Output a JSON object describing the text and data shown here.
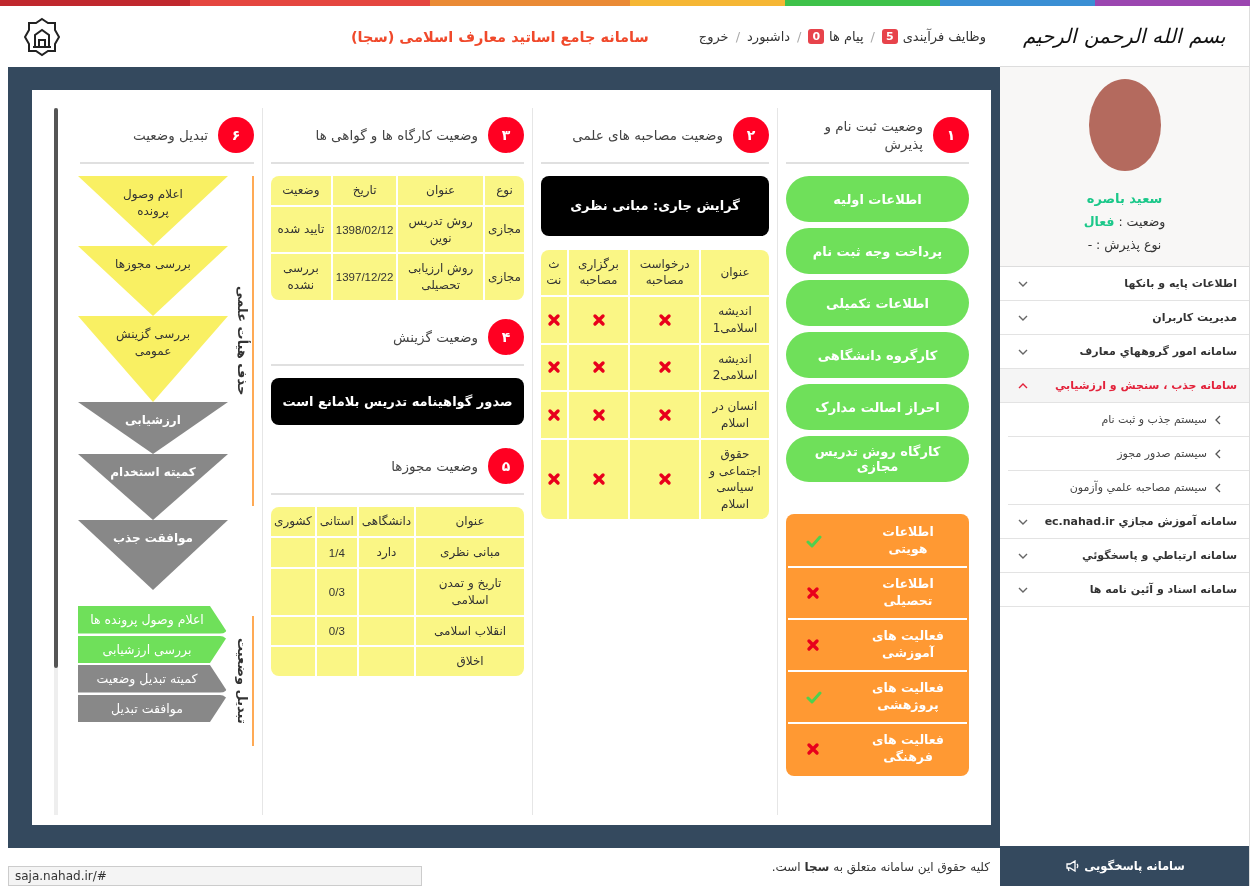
{
  "header": {
    "title": "سامانه جامع اساتید معارف اسلامی (سجا)",
    "nav": [
      {
        "label": "وظایف فرآیندی",
        "badge": "5",
        "separator": "/"
      },
      {
        "label": "پیام ها",
        "badge": "0",
        "separator": "/"
      },
      {
        "label": "داشبورد",
        "separator": "/"
      },
      {
        "label": "خروج"
      }
    ]
  },
  "board": {
    "registration": {
      "number": "۱",
      "title": "وضعیت ثبت نام و پذیرش",
      "steps": [
        "اطلاعات اولیه",
        "پرداخت وجه ثبت نام",
        "اطلاعات تکمیلی",
        "کارگروه دانشگاهی",
        "احراز اصالت مدارک",
        "کارگاه روش تدریس مجازی"
      ],
      "documents": [
        {
          "label": "اطلاعات هویتی",
          "done": true
        },
        {
          "label": "اطلاعات تحصیلی",
          "done": false
        },
        {
          "label": "فعالیت های آموزشی",
          "done": false
        },
        {
          "label": "فعالیت های پروژهشی",
          "done": true
        },
        {
          "label": "فعالیت های فرهنگی",
          "done": false
        }
      ]
    },
    "interviews": {
      "number": "۲",
      "title": "وضعیت مصاحبه های علمی",
      "current": "گرایش جاری: مبانی نظری",
      "columns": [
        "عنوان",
        "درخواست مصاحبه",
        "برگزاری مصاحبه",
        "ث نت"
      ],
      "rows": [
        {
          "title": "اندیشه اسلامی1",
          "marks": [
            false,
            false,
            false
          ]
        },
        {
          "title": "اندیشه اسلامی2",
          "marks": [
            false,
            false,
            false
          ]
        },
        {
          "title": "انسان در اسلام",
          "marks": [
            false,
            false,
            false
          ]
        },
        {
          "title": "حقوق اجتماعی و سیاسی اسلام",
          "marks": [
            false,
            false,
            false
          ]
        }
      ]
    },
    "workshops": {
      "number": "۳",
      "title": "وضعیت کارگاه ها و گواهی ها",
      "columns": [
        "نوع",
        "عنوان",
        "تاریخ",
        "وضعیت"
      ],
      "rows": [
        [
          "مجازی",
          "روش تدریس نوین",
          "1398/02/12",
          "تایید شده"
        ],
        [
          "مجازی",
          "روش ارزیابی تحصیلی",
          "1397/12/22",
          "بررسی نشده"
        ]
      ]
    },
    "selection": {
      "number": "۴",
      "title": "وضعیت گزینش",
      "message": "صدور گواهینامه تدریس بلامانع است"
    },
    "permits": {
      "number": "۵",
      "title": "وضعیت مجوزها",
      "columns": [
        "عنوان",
        "دانشگاهی",
        "استانی",
        "کشوری"
      ],
      "rows": [
        {
          "title": "مبانی نظری",
          "university": "دارد",
          "provincial": "1/4"
        },
        {
          "title": "تاریخ و تمدن اسلامی",
          "provincial": "0/3"
        },
        {
          "title": "انقلاب اسلامی",
          "provincial": "0/3"
        },
        {
          "title": "اخلاق"
        }
      ]
    },
    "status_change": {
      "number": "۶",
      "title": "تبدیل وضعیت",
      "funnel_side_label": "حذف هیأت علمی",
      "funnel": [
        {
          "label": "اعلام وصول پرونده",
          "color": "#f9f063"
        },
        {
          "label": "بررسی مجوزها",
          "color": "#f9f063"
        },
        {
          "label": "بررسی گزینش عمومی",
          "color": "#f9f063"
        },
        {
          "label": "ارزشیابی",
          "color": "#888888"
        },
        {
          "label": "کمیته استخدام",
          "color": "#888888"
        },
        {
          "label": "موافقت جذب",
          "color": "#888888"
        }
      ],
      "stages_side_label": "تبدیل وضعیت",
      "stages": [
        {
          "label": "اعلام وصول پرونده ها",
          "color": "#6fe05a"
        },
        {
          "label": "بررسی ارزشیابی",
          "color": "#6fe05a"
        },
        {
          "label": "کمیته تبدیل وضعیت",
          "color": "#888888"
        },
        {
          "label": "موافقت تبدیل",
          "color": "#888888"
        }
      ]
    }
  },
  "sidebar": {
    "basmala": "بسم الله الرحمن الرحیم",
    "profile": {
      "name": "سعید باصره",
      "status_label": "وضعیت :",
      "status": "فعال",
      "admission": "نوع پذیرش : -"
    },
    "menu": [
      {
        "label": "اطلاعات پایه و بانکها",
        "expanded": false
      },
      {
        "label": "مدیریت کاربران",
        "expanded": false
      },
      {
        "label": "سامانه امور گروههاي معارف",
        "expanded": false
      },
      {
        "label": "سامانه جذب ، سنجش و ارزشيابي",
        "expanded": true,
        "children": [
          {
            "label": "سيستم جذب و ثبت نام"
          },
          {
            "label": "سيستم صدور مجوز"
          },
          {
            "label": "سيستم مصاحبه علمي وآزمون"
          }
        ]
      },
      {
        "label": "سامانه آموزش مجازي ec.nahad.ir",
        "expanded": false
      },
      {
        "label": "سامانه ارتباطي و پاسخگوئي",
        "expanded": false
      },
      {
        "label": "سامانه اسناد و آئین نامه ها",
        "expanded": false
      }
    ],
    "support_button": "سامانه پاسخگویی"
  },
  "footer": {
    "copyright": "کلیه حقوق این سامانه متعلق به **سجا** است."
  },
  "status_bar": {
    "url": "saja.nahad.ir/#"
  }
}
